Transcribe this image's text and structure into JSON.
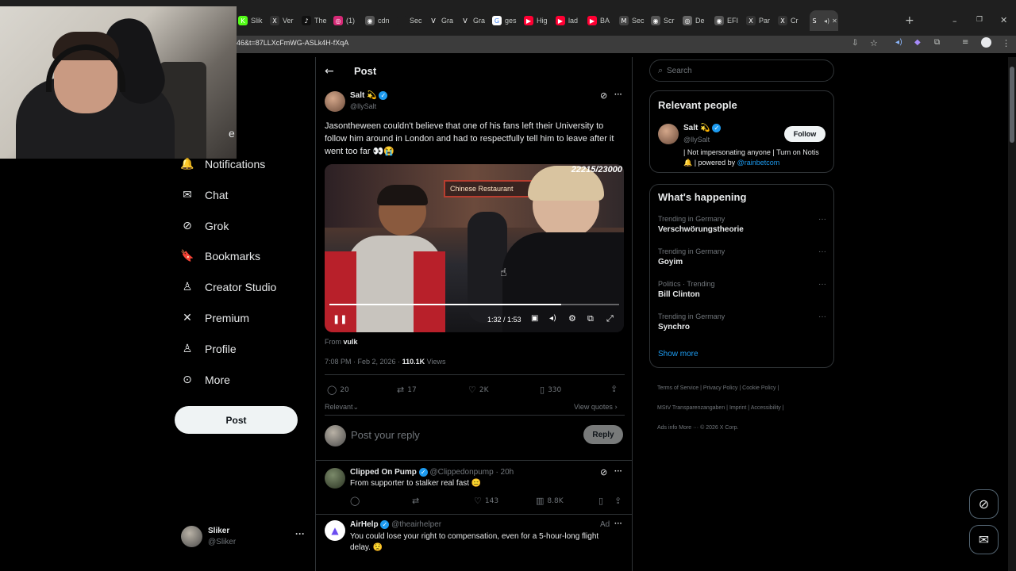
{
  "browser": {
    "url": "46&t=87LLXcFmWG-ASLk4H-fXqA",
    "tabs": [
      {
        "label": "Slik",
        "icon": "K",
        "color": "#53fc18"
      },
      {
        "label": "Ver",
        "icon": "X",
        "color": "#333333"
      },
      {
        "label": "The",
        "icon": "♪",
        "color": "#111111"
      },
      {
        "label": "(1)",
        "icon": "◎",
        "color": "#d62976"
      },
      {
        "label": "cdn",
        "icon": "◉",
        "color": "#555555"
      },
      {
        "label": "Sec",
        "icon": "",
        "color": "#1f1f1f"
      },
      {
        "label": "Gra",
        "icon": "V",
        "color": "#1f1f1f"
      },
      {
        "label": "Gra",
        "icon": "V",
        "color": "#1f1f1f"
      },
      {
        "label": "ges",
        "icon": "G",
        "color": "#ffffff"
      },
      {
        "label": "Hig",
        "icon": "▶",
        "color": "#ff0033"
      },
      {
        "label": "lad",
        "icon": "▶",
        "color": "#ff0033"
      },
      {
        "label": "BA",
        "icon": "▶",
        "color": "#ff0033"
      },
      {
        "label": "Sec",
        "icon": "M",
        "color": "#444444"
      },
      {
        "label": "Scr",
        "icon": "◉",
        "color": "#555555"
      },
      {
        "label": "De",
        "icon": "◎",
        "color": "#666666"
      },
      {
        "label": "EFI",
        "icon": "◉",
        "color": "#555555"
      },
      {
        "label": "Par",
        "icon": "X",
        "color": "#333333"
      },
      {
        "label": "Cr",
        "icon": "X",
        "color": "#333333"
      },
      {
        "label": "",
        "icon": "S",
        "color": "#3c3c3c"
      }
    ]
  },
  "nav": {
    "partial_label": "e",
    "items": [
      {
        "name": "notifications",
        "label": "Notifications",
        "icon": "🔔"
      },
      {
        "name": "chat",
        "label": "Chat",
        "icon": "✉"
      },
      {
        "name": "grok",
        "label": "Grok",
        "icon": "⊘"
      },
      {
        "name": "bookmarks",
        "label": "Bookmarks",
        "icon": "🔖"
      },
      {
        "name": "creator-studio",
        "label": "Creator Studio",
        "icon": "♙"
      },
      {
        "name": "premium",
        "label": "Premium",
        "icon": "✕"
      },
      {
        "name": "profile",
        "label": "Profile",
        "icon": "♙"
      },
      {
        "name": "more",
        "label": "More",
        "icon": "⊙"
      }
    ],
    "post_button": "Post",
    "account": {
      "name": "Sliker",
      "handle": "@Sliker"
    }
  },
  "header": {
    "title": "Post"
  },
  "post": {
    "author": "Salt 💫",
    "handle": "@llySalt",
    "text": "Jasontheween couldn't believe that one of his fans left their University to follow him around in London and had to respectfully tell him to leave after it went too far 👀😭",
    "video": {
      "overlay_count": "22215/23000",
      "sign_text": "Chinese Restaurant",
      "time": "1:32 / 1:53",
      "progress": 0.8
    },
    "from_label": "From",
    "from_name": "vulk",
    "timestamp": "7:08 PM · Feb 2, 2026 ·",
    "views": "110.1K",
    "views_label": "Views",
    "stats": {
      "replies": "20",
      "reposts": "17",
      "likes": "2K",
      "bookmarks": "330"
    },
    "sort_label": "Relevant",
    "view_quotes": "View quotes"
  },
  "reply_box": {
    "placeholder": "Post your reply",
    "button": "Reply"
  },
  "replies": [
    {
      "author": "Clipped On Pump",
      "handle": "@Clippedonpump",
      "time": "· 20h",
      "text": "From supporter to stalker real fast 😑",
      "likes": "143",
      "views": "8.8K"
    },
    {
      "author": "AirHelp",
      "handle": "@theairhelper",
      "ad_label": "Ad",
      "text": "You could lose your right to compensation, even for a 5-hour-long flight delay. 😟"
    }
  ],
  "sidebar": {
    "search_placeholder": "Search",
    "relevant_title": "Relevant people",
    "person": {
      "name": "Salt 💫",
      "handle": "@llySalt",
      "follow": "Follow",
      "bio": "| Not impersonating anyone | Turn on Notis 🔔 | powered by",
      "bio_link": "@rainbetcom"
    },
    "happening_title": "What's happening",
    "trends": [
      {
        "meta": "Trending in Germany",
        "name": "Verschwörungstheorie"
      },
      {
        "meta": "Trending in Germany",
        "name": "Goyim"
      },
      {
        "meta": "Politics · Trending",
        "name": "Bill Clinton"
      },
      {
        "meta": "Trending in Germany",
        "name": "Synchro"
      }
    ],
    "show_more": "Show more",
    "footer": [
      "Terms of Service",
      "Privacy Policy",
      "Cookie Policy",
      "MStV Transparenzangaben",
      "Imprint",
      "Accessibility",
      "Ads info",
      "More ···",
      "© 2026 X Corp."
    ]
  },
  "colors": {
    "accent": "#1d9bf0",
    "bg": "#000000",
    "border": "#2f3336",
    "muted": "#71767b"
  }
}
